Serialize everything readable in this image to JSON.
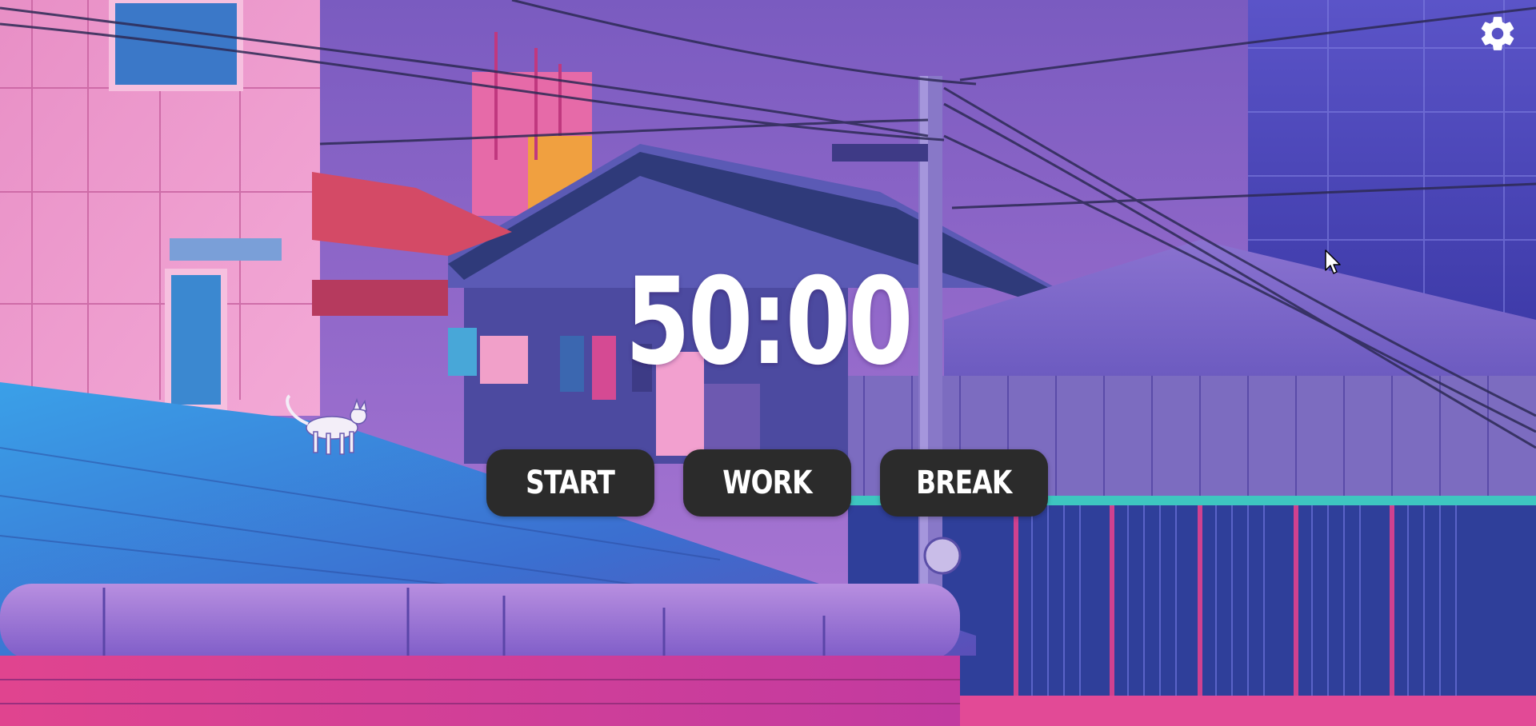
{
  "app": {
    "timer_display": "50:00"
  },
  "controls": {
    "start_label": "START",
    "work_label": "WORK",
    "break_label": "BREAK"
  },
  "icons": {
    "settings": "gear-icon",
    "cursor": "mouse-pointer-icon"
  },
  "colors": {
    "button_background": "#2b2b2b",
    "button_text": "#ffffff",
    "timer_text": "#ffffff",
    "settings_icon": "#ffffff"
  }
}
